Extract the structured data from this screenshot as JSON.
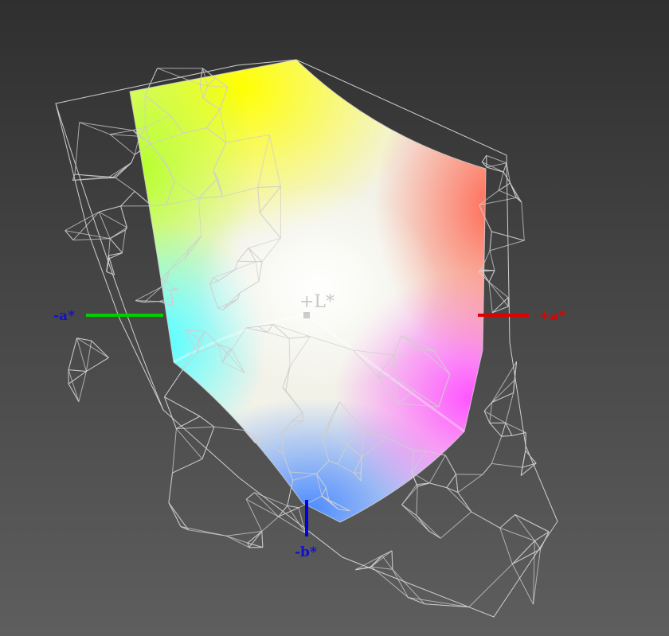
{
  "axes": {
    "l_plus": {
      "label": "+L*",
      "color": "#c8c8c8"
    },
    "a_minus": {
      "label": "-a*",
      "color": "#1010d0",
      "line_color": "#00d000"
    },
    "a_plus": {
      "label": "+a*",
      "color": "#e00000",
      "line_color": "#e00000"
    },
    "b_minus": {
      "label": "-b*",
      "color": "#1010d0",
      "line_color": "#0000e0"
    }
  },
  "colors": {
    "background_top": "#2f2f2f",
    "background_bottom": "#5e5e5e",
    "wireframe": "#cfcfcf",
    "solid_yellow": "#ffff00",
    "solid_red": "#ff7a6a",
    "solid_magenta": "#ff60ff",
    "solid_blue": "#5a9cff",
    "solid_cyan": "#60ffff",
    "solid_green": "#c8ff40",
    "solid_white": "#ffffff"
  }
}
